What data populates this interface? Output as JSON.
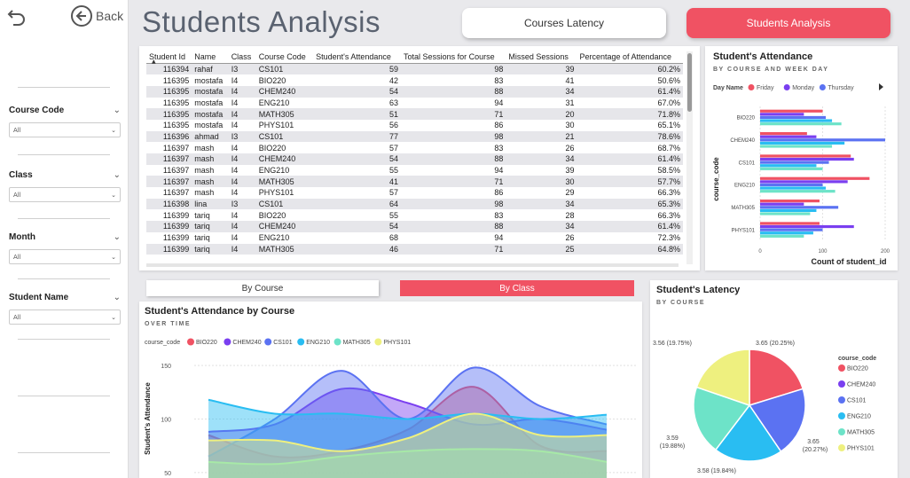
{
  "sidebar": {
    "back_label": "Back",
    "slicers": [
      {
        "title": "Course Code",
        "value": "All"
      },
      {
        "title": "Class",
        "value": "All"
      },
      {
        "title": "Month",
        "value": "All"
      },
      {
        "title": "Student Name",
        "value": "All"
      }
    ]
  },
  "header": {
    "title": "Students Analysis",
    "nav_courses": "Courses Latency",
    "nav_students": "Students Analysis"
  },
  "table": {
    "columns": [
      "Student Id",
      "Name",
      "Class",
      "Course Code",
      "Student's Attendance",
      "Total Sessions for Course",
      "Missed Sessions",
      "Percentage of Attendance"
    ],
    "rows": [
      [
        "116394",
        "rahaf",
        "I3",
        "CS101",
        "59",
        "98",
        "39",
        "60.2%"
      ],
      [
        "116395",
        "mostafa",
        "I4",
        "BIO220",
        "42",
        "83",
        "41",
        "50.6%"
      ],
      [
        "116395",
        "mostafa",
        "I4",
        "CHEM240",
        "54",
        "88",
        "34",
        "61.4%"
      ],
      [
        "116395",
        "mostafa",
        "I4",
        "ENG210",
        "63",
        "94",
        "31",
        "67.0%"
      ],
      [
        "116395",
        "mostafa",
        "I4",
        "MATH305",
        "51",
        "71",
        "20",
        "71.8%"
      ],
      [
        "116395",
        "mostafa",
        "I4",
        "PHYS101",
        "56",
        "86",
        "30",
        "65.1%"
      ],
      [
        "116396",
        "ahmad",
        "I3",
        "CS101",
        "77",
        "98",
        "21",
        "78.6%"
      ],
      [
        "116397",
        "mash",
        "I4",
        "BIO220",
        "57",
        "83",
        "26",
        "68.7%"
      ],
      [
        "116397",
        "mash",
        "I4",
        "CHEM240",
        "54",
        "88",
        "34",
        "61.4%"
      ],
      [
        "116397",
        "mash",
        "I4",
        "ENG210",
        "55",
        "94",
        "39",
        "58.5%"
      ],
      [
        "116397",
        "mash",
        "I4",
        "MATH305",
        "41",
        "71",
        "30",
        "57.7%"
      ],
      [
        "116397",
        "mash",
        "I4",
        "PHYS101",
        "57",
        "86",
        "29",
        "66.3%"
      ],
      [
        "116398",
        "lina",
        "I3",
        "CS101",
        "64",
        "98",
        "34",
        "65.3%"
      ],
      [
        "116399",
        "tariq",
        "I4",
        "BIO220",
        "55",
        "83",
        "28",
        "66.3%"
      ],
      [
        "116399",
        "tariq",
        "I4",
        "CHEM240",
        "54",
        "88",
        "34",
        "61.4%"
      ],
      [
        "116399",
        "tariq",
        "I4",
        "ENG210",
        "68",
        "94",
        "26",
        "72.3%"
      ],
      [
        "116399",
        "tariq",
        "I4",
        "MATH305",
        "46",
        "71",
        "25",
        "64.8%"
      ]
    ]
  },
  "bar_chart": {
    "title": "Student's Attendance",
    "subtitle": "BY COURSE AND WEEK DAY",
    "legend_title": "Day Name",
    "x_axis_title": "Count of student_id",
    "y_axis_title": "course_code"
  },
  "toggles": {
    "by_course": "By Course",
    "by_class": "By Class"
  },
  "area_chart": {
    "title": "Student's Attendance by Course",
    "subtitle": "OVER TIME",
    "legend_title": "course_code",
    "y_axis_title": "Student's Attendance"
  },
  "pie_chart": {
    "title": "Student's Latency",
    "subtitle": "BY COURSE",
    "legend_title": "course_code"
  },
  "colors": {
    "accent": "#f05263",
    "BIO220": "#f05263",
    "CHEM240": "#7a3ff0",
    "CS101": "#5b72f2",
    "ENG210": "#29bdf2",
    "MATH305": "#6de3c8",
    "PHYS101": "#eef07f"
  },
  "chart_data": [
    {
      "type": "bar",
      "title": "Student's Attendance",
      "subtitle": "BY COURSE AND WEEK DAY",
      "xlabel": "Count of student_id",
      "ylabel": "course_code",
      "orientation": "horizontal",
      "xlim": [
        0,
        200
      ],
      "x_ticks": [
        0,
        100,
        200
      ],
      "categories": [
        "BIO220",
        "CHEM240",
        "CS101",
        "ENG210",
        "MATH305",
        "PHYS101"
      ],
      "legend_title": "Day Name",
      "series": [
        {
          "name": "Friday",
          "color": "#f05263",
          "values": [
            100,
            75,
            145,
            175,
            95,
            95
          ]
        },
        {
          "name": "Monday",
          "color": "#7a3ff0",
          "values": [
            70,
            90,
            150,
            140,
            70,
            150
          ]
        },
        {
          "name": "Thursday",
          "color": "#5b72f2",
          "values": [
            105,
            200,
            110,
            100,
            125,
            100
          ]
        },
        {
          "series_color_only": true,
          "color": "#29bdf2",
          "values": [
            115,
            135,
            90,
            105,
            90,
            85
          ]
        },
        {
          "series_color_only": true,
          "color": "#6de3c8",
          "values": [
            130,
            115,
            100,
            120,
            80,
            70
          ]
        }
      ]
    },
    {
      "type": "area",
      "title": "Student's Attendance by Course",
      "subtitle": "OVER TIME",
      "ylabel": "Student's Attendance",
      "y_ticks": [
        50,
        100,
        150
      ],
      "ylim": [
        40,
        160
      ],
      "legend_title": "course_code",
      "series": [
        {
          "name": "BIO220",
          "color": "#f05263",
          "values": [
            85,
            65,
            70,
            90,
            130,
            75,
            70
          ]
        },
        {
          "name": "CHEM240",
          "color": "#7a3ff0",
          "values": [
            88,
            95,
            128,
            115,
            95,
            100,
            90
          ]
        },
        {
          "name": "CS101",
          "color": "#5b72f2",
          "values": [
            65,
            100,
            145,
            100,
            148,
            112,
            95
          ]
        },
        {
          "name": "ENG210",
          "color": "#29bdf2",
          "values": [
            118,
            105,
            105,
            100,
            105,
            100,
            104
          ]
        },
        {
          "name": "MATH305",
          "color": "#6de3c8",
          "values": [
            60,
            58,
            65,
            70,
            72,
            70,
            60
          ]
        },
        {
          "name": "PHYS101",
          "color": "#eef07f",
          "values": [
            80,
            80,
            70,
            82,
            105,
            85,
            85
          ]
        }
      ]
    },
    {
      "type": "pie",
      "title": "Student's Latency",
      "subtitle": "BY COURSE",
      "legend_title": "course_code",
      "slices": [
        {
          "label": "BIO220",
          "value": 3.65,
          "pct": "20.25%",
          "color": "#f05263"
        },
        {
          "label": "CHEM240",
          "value": 0,
          "pct": "",
          "color": "#7a3ff0"
        },
        {
          "label": "CS101",
          "value": 3.65,
          "pct": "20.27%",
          "color": "#5b72f2"
        },
        {
          "label": "ENG210",
          "value": 3.58,
          "pct": "19.84%",
          "color": "#29bdf2"
        },
        {
          "label": "MATH305",
          "value": 3.59,
          "pct": "19.88%",
          "color": "#6de3c8"
        },
        {
          "label": "PHYS101",
          "value": 3.56,
          "pct": "19.75%",
          "color": "#eef07f"
        }
      ],
      "data_labels": [
        "3.65 (20.25%)",
        "3.65 (20.27%)",
        "3.58 (19.84%)",
        "3.59 (19.88%)",
        "3.56 (19.75%)"
      ]
    }
  ]
}
